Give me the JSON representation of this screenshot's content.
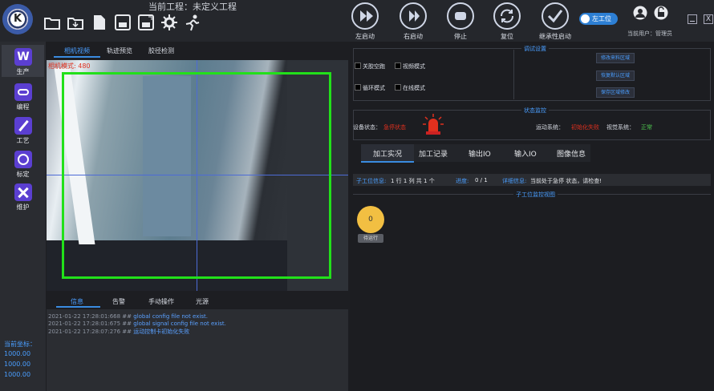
{
  "app": {
    "project_title": "当前工程：未定义工程"
  },
  "toolbar": {
    "icons": [
      "open-folder-icon",
      "import-folder-icon",
      "new-file-icon",
      "save-icon",
      "save-as-icon",
      "settings-gear-icon",
      "run-icon"
    ]
  },
  "actions": [
    {
      "label": "左启动",
      "icon": "play-left-icon"
    },
    {
      "label": "右启动",
      "icon": "play-right-icon"
    },
    {
      "label": "停止",
      "icon": "stop-icon"
    },
    {
      "label": "复位",
      "icon": "reset-icon"
    },
    {
      "label": "继承性启动",
      "icon": "check-icon"
    }
  ],
  "station_toggle": {
    "label": "左工位",
    "on": true
  },
  "user": {
    "label": "当前用户：管理员"
  },
  "sidebar": {
    "items": [
      {
        "label": "生产",
        "icon": "production-icon"
      },
      {
        "label": "编程",
        "icon": "programming-icon"
      },
      {
        "label": "工艺",
        "icon": "process-icon"
      },
      {
        "label": "标定",
        "icon": "calibration-icon"
      },
      {
        "label": "维护",
        "icon": "maintenance-icon"
      }
    ],
    "coord_title": "当前坐标：",
    "coords": [
      "1000.00",
      "1000.00",
      "1000.00"
    ]
  },
  "camera": {
    "tabs": [
      "相机视频",
      "轨迹预览",
      "胶径检测"
    ],
    "status": "相机模式:  480"
  },
  "log": {
    "tabs": [
      "信息",
      "告警",
      "手动操作",
      "光源"
    ],
    "lines": [
      {
        "time": "2021-01-22 17:28:01:668 ##",
        "msg": "global config file not exist."
      },
      {
        "time": "2021-01-22 17:28:01:675 ##",
        "msg": "global signal config file not exist."
      },
      {
        "time": "2021-01-22 17:28:07:276 ##",
        "msg": "运动控制卡初始化失败"
      }
    ]
  },
  "debug": {
    "title": "调试设置",
    "checks": [
      "关胶空跑",
      "视频模式",
      "循环模式",
      "在线模式"
    ],
    "buttons": [
      "修改来料区域",
      "恢复默认区域",
      "保存区域修改"
    ]
  },
  "status_monitor": {
    "title": "状态监控",
    "device_label": "设备状态：",
    "device_value": "急停状态",
    "motion_label": "运动系统：",
    "motion_value": "初始化失败",
    "vision_label": "视觉系统：",
    "vision_value": "正常"
  },
  "right_tabs": [
    "加工实况",
    "加工记录",
    "输出IO",
    "输入IO",
    "图像信息"
  ],
  "info_row": {
    "sub_label": "子工位信息:",
    "sub_value": "1 行 1 列 共 1 个",
    "progress_label": "进度:",
    "progress_value": "0 / 1",
    "detail_label": "详细信息:",
    "detail_value": "当前处于急停 状态，请检查!"
  },
  "sub_monitor": {
    "title": "子工位监控视图",
    "station_value": "0",
    "station_status": "待运行"
  },
  "colors": {
    "accent": "#3a8be0",
    "alarm": "#e0301e",
    "ok": "#4ec84e",
    "roi": "#22e01a"
  }
}
